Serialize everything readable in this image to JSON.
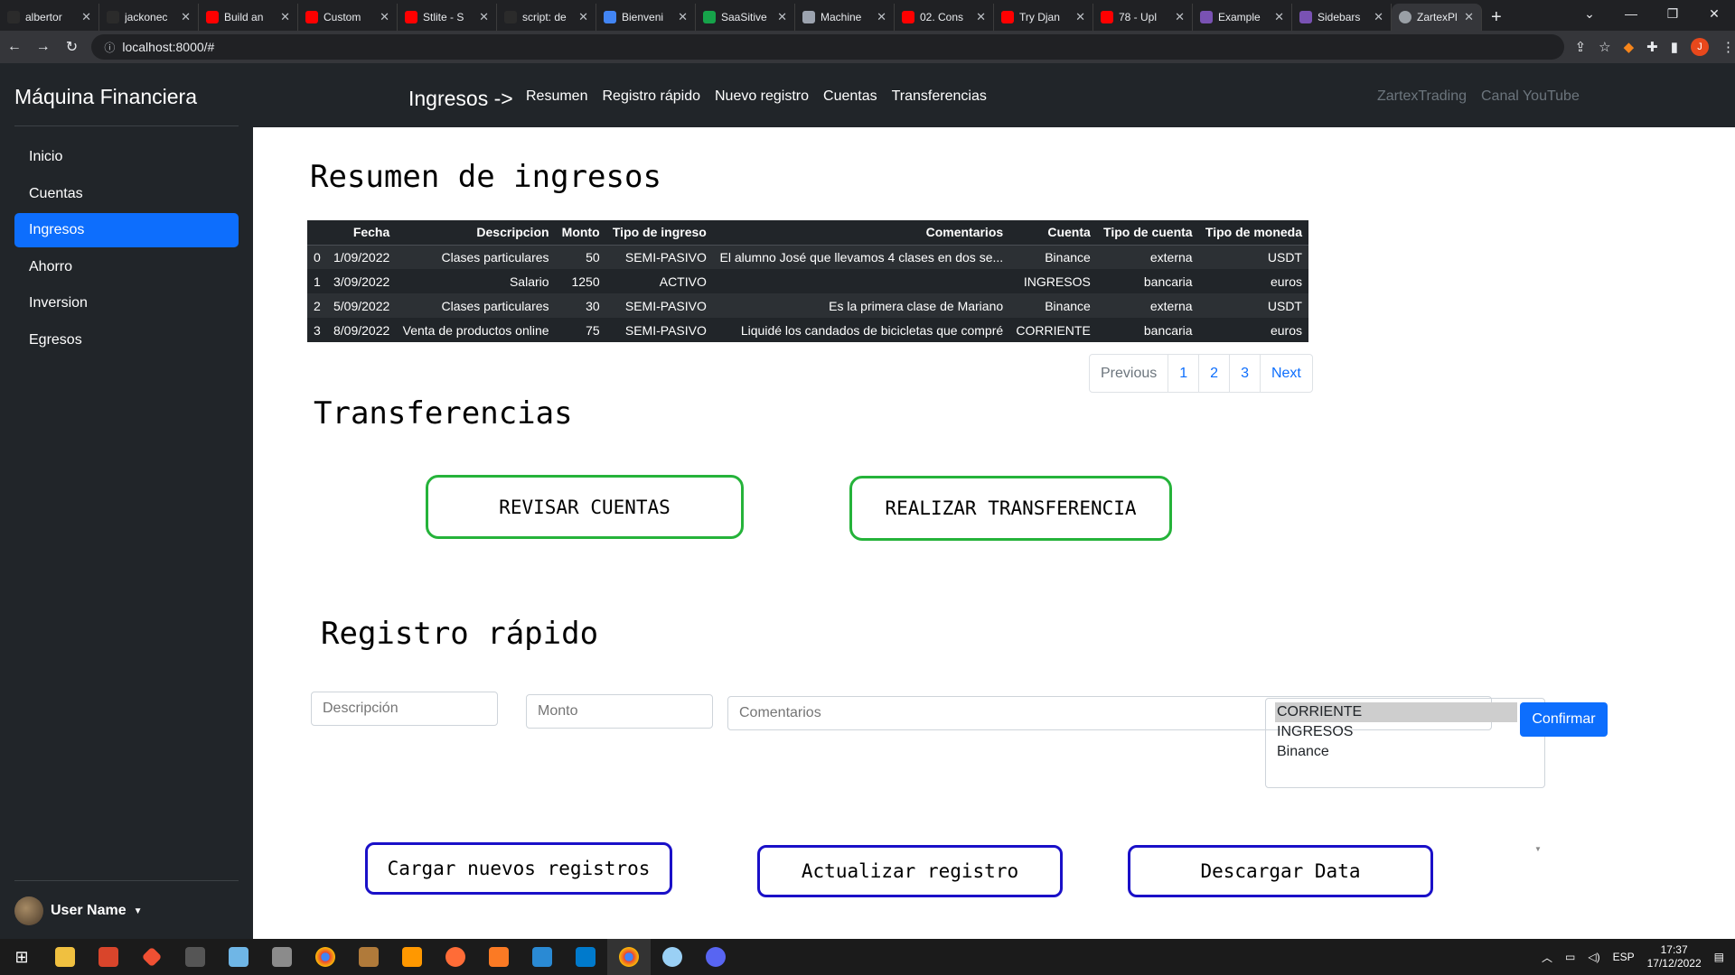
{
  "browser": {
    "tabs": [
      {
        "title": "albertor",
        "color": "#2b2b2b"
      },
      {
        "title": "jackonec",
        "color": "#2b2b2b"
      },
      {
        "title": "Build an",
        "color": "#ff0000"
      },
      {
        "title": "Custom",
        "color": "#ff0000"
      },
      {
        "title": "Stlite - S",
        "color": "#ff0000"
      },
      {
        "title": "script: de",
        "color": "#2b2b2b"
      },
      {
        "title": "Bienveni",
        "color": "#4285f4"
      },
      {
        "title": "SaaSitive",
        "color": "#16a34a"
      },
      {
        "title": "Machine",
        "color": "#9ca3af"
      },
      {
        "title": "02. Cons",
        "color": "#ff0000"
      },
      {
        "title": "Try Djan",
        "color": "#ff0000"
      },
      {
        "title": "78 - Upl",
        "color": "#ff0000"
      },
      {
        "title": "Example",
        "color": "#7952b3"
      },
      {
        "title": "Sidebars",
        "color": "#7952b3"
      }
    ],
    "active_tab": "ZartexPl",
    "url": "localhost:8000/#",
    "profile_initial": "J"
  },
  "nav": {
    "brand": "Máquina Financiera",
    "section": "Ingresos ->",
    "links": [
      "Resumen",
      "Registro rápido",
      "Nuevo registro",
      "Cuentas",
      "Transferencias"
    ],
    "right_links": [
      "ZartexTrading",
      "Canal YouTube"
    ]
  },
  "sidebar": {
    "items": [
      "Inicio",
      "Cuentas",
      "Ingresos",
      "Ahorro",
      "Inversion",
      "Egresos"
    ],
    "active": "Ingresos",
    "user": "User Name"
  },
  "resumen": {
    "title": "Resumen de ingresos",
    "columns": [
      "",
      "Fecha",
      "Descripcion",
      "Monto",
      "Tipo de ingreso",
      "Comentarios",
      "Cuenta",
      "Tipo de cuenta",
      "Tipo de moneda"
    ],
    "rows": [
      [
        "0",
        "1/09/2022",
        "Clases particulares",
        "50",
        "SEMI-PASIVO",
        "El alumno José que llevamos 4 clases en dos se...",
        "Binance",
        "externa",
        "USDT"
      ],
      [
        "1",
        "3/09/2022",
        "Salario",
        "1250",
        "ACTIVO",
        "",
        "INGRESOS",
        "bancaria",
        "euros"
      ],
      [
        "2",
        "5/09/2022",
        "Clases particulares",
        "30",
        "SEMI-PASIVO",
        "Es la primera clase de Mariano",
        "Binance",
        "externa",
        "USDT"
      ],
      [
        "3",
        "8/09/2022",
        "Venta de productos online",
        "75",
        "SEMI-PASIVO",
        "Liquidé los candados de bicicletas que compré",
        "CORRIENTE",
        "bancaria",
        "euros"
      ]
    ],
    "pagination": [
      "Previous",
      "1",
      "2",
      "3",
      "Next"
    ]
  },
  "transferencias": {
    "title": "Transferencias",
    "btn_revisar": "REVISAR CUENTAS",
    "btn_realizar": "REALIZAR TRANSFERENCIA"
  },
  "registro": {
    "title": "Registro rápido",
    "placeholder_desc": "Descripción",
    "placeholder_monto": "Monto",
    "placeholder_coment": "Comentarios",
    "accounts": [
      "CORRIENTE",
      "INGRESOS",
      "Binance"
    ],
    "selected_account": "CORRIENTE",
    "confirm": "Confirmar"
  },
  "actions": {
    "cargar": "Cargar nuevos registros",
    "actualizar": "Actualizar registro",
    "descargar": "Descargar Data"
  },
  "taskbar": {
    "lang": "ESP",
    "time": "17:37",
    "date": "17/12/2022"
  }
}
